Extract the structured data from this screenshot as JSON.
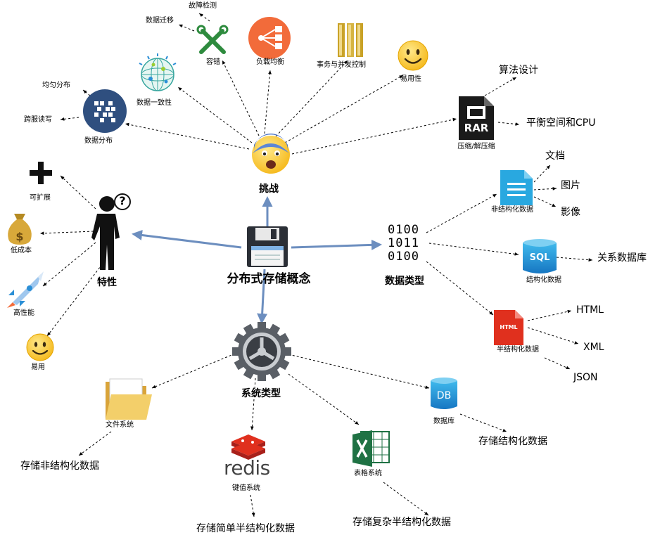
{
  "center": {
    "title": "分布式存储概念"
  },
  "challenges": {
    "title": "挑战",
    "items": {
      "fault_detect": "故障检测",
      "migration": "数据迁移",
      "fault_tolerance": "容错",
      "load_balance": "负载均衡",
      "transaction": "事务与并发控制",
      "usability": "易用性",
      "consistency": "数据一致性",
      "even_dist": "均匀分布",
      "cross_server": "跨服读写",
      "distribution": "数据分布",
      "compression": "压缩/解压缩",
      "algorithm": "算法设计",
      "balance": "平衡空间和CPU"
    }
  },
  "features": {
    "title": "特性",
    "items": {
      "scalable": "可扩展",
      "low_cost": "低成本",
      "high_perf": "高性能",
      "easy": "易用"
    }
  },
  "data_types": {
    "title": "数据类型",
    "binary": [
      "0100",
      "1011",
      "0100"
    ],
    "unstructured": {
      "label": "非结构化数据",
      "children": [
        "文档",
        "图片",
        "影像"
      ]
    },
    "structured": {
      "label": "结构化数据",
      "icon_text": "SQL",
      "child": "关系数据库"
    },
    "semi": {
      "label": "半结构化数据",
      "icon_text": "HTML",
      "children": [
        "HTML",
        "XML",
        "JSON"
      ]
    }
  },
  "systems": {
    "title": "系统类型",
    "file": {
      "label": "文件系统",
      "note": "存储非结构化数据"
    },
    "kv": {
      "label": "键值系统",
      "logo": "redis",
      "note": "存储简单半结构化数据"
    },
    "table": {
      "label": "表格系统",
      "note": "存储复杂半结构化数据"
    },
    "db": {
      "label": "数据库",
      "icon_text": "DB",
      "note": "存储结构化数据"
    }
  },
  "icons": {
    "center": "floppy-disk-icon",
    "challenges": "anxious-face-icon",
    "features": "thinking-person-icon",
    "fault_detect": "search-icon",
    "migration": "migrate-icon",
    "fault_tolerance": "tools-icon",
    "load_balance": "network-icon",
    "transaction": "columns-icon",
    "usability": "smile-icon",
    "consistency": "globe-icon",
    "distribution": "grid-icon",
    "compression": "rar-file-icon",
    "scalable": "plus-icon",
    "low_cost": "money-bag-icon",
    "high_perf": "rocket-icon",
    "easy": "smile-icon",
    "unstructured": "document-icon",
    "structured": "sql-database-icon",
    "semi": "html-file-icon",
    "systems": "gear-icon",
    "file": "folder-icon",
    "kv": "redis-icon",
    "table": "excel-icon",
    "db": "database-icon"
  },
  "colors": {
    "arrow": "#6C8EBF",
    "orange": "#F26B3A",
    "gold": "#C9A227",
    "navy": "#2F4F7F",
    "sky": "#29A8E0",
    "red": "#E0301E",
    "green": "#1F7244"
  }
}
